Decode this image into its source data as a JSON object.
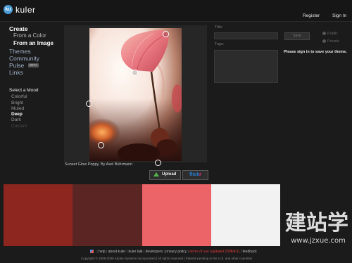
{
  "header": {
    "logo_badge": "ku",
    "app_name": "kuler",
    "register": "Register",
    "sign_in": "Sign In"
  },
  "nav": {
    "create": "Create",
    "from_a_color": "From a Color",
    "from_an_image": "From an Image",
    "themes": "Themes",
    "community": "Community",
    "pulse": "Pulse",
    "beta": "BETA",
    "links": "Links"
  },
  "mood": {
    "heading": "Select a Mood",
    "items": [
      "Colorful",
      "Bright",
      "Muted",
      "Deep",
      "Dark",
      "Custom"
    ],
    "selected": "Deep"
  },
  "image": {
    "caption": "Sunset Glow Poppy, By Axel Bührmann",
    "upload_label": "Upload",
    "flickr_part1": "flick",
    "flickr_part2": "r"
  },
  "form": {
    "title_label": "Title:",
    "tags_label": "Tags:",
    "save_label": "Save",
    "public_label": "Public",
    "private_label": "Private",
    "signin_note": "Please sign in to save your theme."
  },
  "swatches": [
    "#8e2620",
    "#5a2523",
    "#ec6368",
    "#f2f2f2",
    "#1f1f1f"
  ],
  "footer": {
    "help": "help",
    "about": "about kuler",
    "talk": "kuler talk",
    "developers": "developers",
    "privacy": "privacy policy",
    "terms": "terms of use (updated 2008/4/1)",
    "feedback": "feedback",
    "copyright": "Copyright © 2006-2008 Adobe Systems Incorporated | All rights reserved | Patents pending in the U.S. and other countries"
  },
  "watermark": {
    "chars": "建站学",
    "url": "www.jzxue.com"
  }
}
